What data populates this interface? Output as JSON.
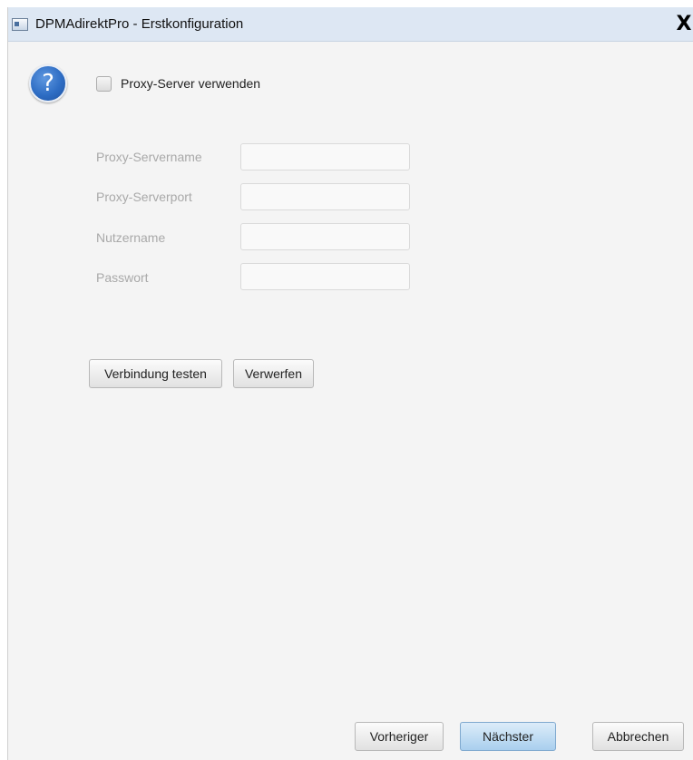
{
  "window": {
    "title": "DPMAdirektPro - Erstkonfiguration",
    "close_label": "X"
  },
  "dialog": {
    "help_glyph": "?",
    "proxy_checkbox_label": "Proxy-Server verwenden",
    "proxy_checkbox_checked": false,
    "fields": {
      "servername_label": "Proxy-Servername",
      "servername_value": "",
      "serverport_label": "Proxy-Serverport",
      "serverport_value": "",
      "username_label": "Nutzername",
      "username_value": "",
      "password_label": "Passwort",
      "password_value": ""
    },
    "test_button_label": "Verbindung testen",
    "discard_button_label": "Verwerfen"
  },
  "footer": {
    "previous_label": "Vorheriger",
    "next_label": "Nächster",
    "cancel_label": "Abbrechen"
  },
  "icons": {
    "app": "window-app-icon",
    "help": "question-icon",
    "close": "close-icon"
  },
  "colors": {
    "titlebar_bg": "#dde7f3",
    "help_icon_blue": "#2e6dc4",
    "default_button": "#a9cfee",
    "disabled_label": "#a9a9a9"
  }
}
